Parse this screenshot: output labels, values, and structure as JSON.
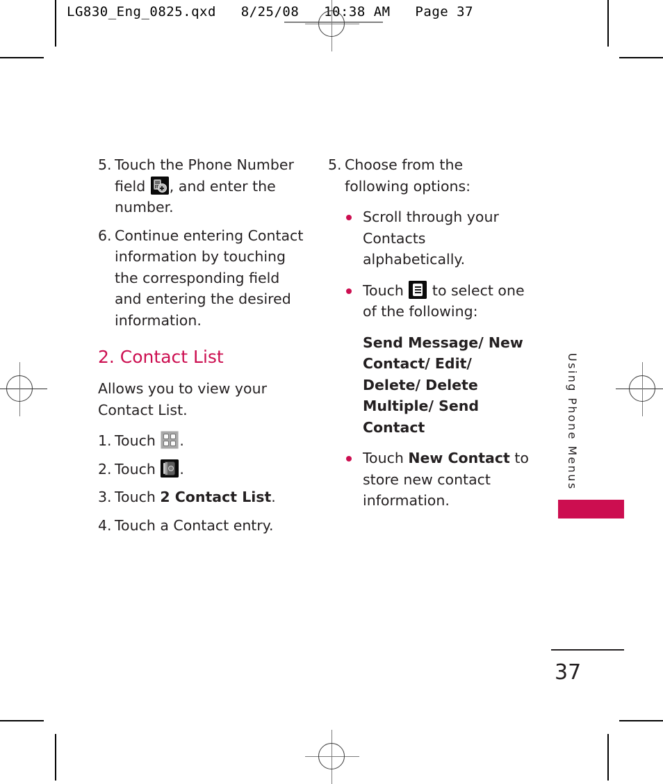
{
  "print_header": {
    "text": "LG830_Eng_0825.qxd   8/25/08   10:38 AM   Page 37"
  },
  "left_column": {
    "step5": {
      "number": "5.",
      "text_before_icon": "Touch the Phone Number field",
      "icon": "add-phone-number-icon",
      "text_after_icon": ", and enter the number."
    },
    "step6": {
      "number": "6.",
      "text": "Continue entering Contact information by touching the corresponding field and entering the desired information."
    },
    "section_heading": "2. Contact List",
    "section_intro": "Allows you to view your Contact List.",
    "step1": {
      "number": "1.",
      "text_before_icon": "Touch",
      "icon": "menu-grid-icon",
      "text_after_icon": "."
    },
    "step2": {
      "number": "2.",
      "text_before_icon": "Touch",
      "icon": "contacts-book-icon",
      "text_after_icon": "."
    },
    "step3": {
      "number": "3.",
      "text_before_bold": "Touch ",
      "bold_text": "2 Contact List",
      "text_after_bold": "."
    },
    "step4": {
      "number": "4.",
      "text": "Touch a Contact entry."
    }
  },
  "right_column": {
    "step5": {
      "number": "5.",
      "text": "Choose from the following options:"
    },
    "bullet1": {
      "text": "Scroll through your Contacts alphabetically."
    },
    "bullet2": {
      "text_before_icon": "Touch",
      "icon": "options-list-icon",
      "text_after_icon": "to select one of the following:"
    },
    "options_block": "Send Message/ New Contact/ Edit/ Delete/ Delete Multiple/ Send Contact",
    "bullet3": {
      "text_before_bold": "Touch ",
      "bold_text": "New Contact",
      "text_after_bold": " to store new contact information."
    }
  },
  "side_tab": {
    "label": "Using Phone Menus",
    "bar_color": "#cc0e50"
  },
  "footer": {
    "page_number": "37"
  },
  "colors": {
    "accent": "#cc0e50",
    "text": "#231f20"
  }
}
